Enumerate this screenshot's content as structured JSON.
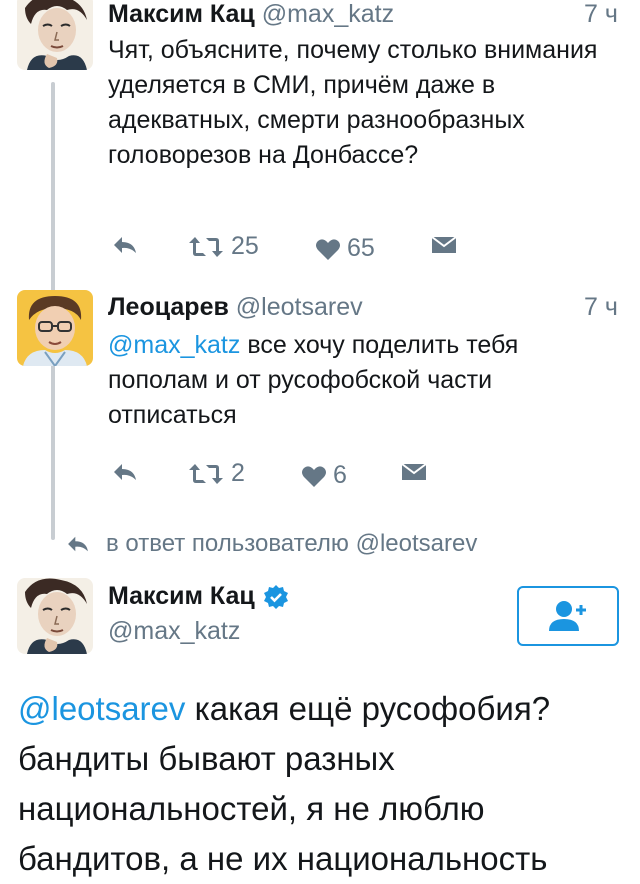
{
  "tweets": [
    {
      "name": "Максим Кац",
      "handle": "@max_katz",
      "time": "7 ч",
      "text": "Чят, объясните, почему столько внимания уделяется в СМИ, причём даже в адекватных, смерти разнообразных головорезов на Донбассе?",
      "retweets": "25",
      "likes": "65"
    },
    {
      "name": "Леоцарев",
      "handle": "@leotsarev",
      "time": "7 ч",
      "mention": "@max_katz",
      "text": "все хочу поделить тебя пополам и от русофобской части отписаться",
      "retweets": "2",
      "likes": "6"
    }
  ],
  "reply_context": "в ответ пользователю @leotsarev",
  "main_tweet": {
    "name": "Максим Кац",
    "handle": "@max_katz",
    "verified": true,
    "mention": "@leotsarev",
    "text_lines": [
      "какая ещё русофобия?",
      "бандиты бывают разных",
      "национальностей, я не люблю",
      "бандитов, а не их национальность"
    ]
  },
  "colors": {
    "accent": "#1b95e0",
    "muted": "#657786",
    "text": "#14171a"
  }
}
